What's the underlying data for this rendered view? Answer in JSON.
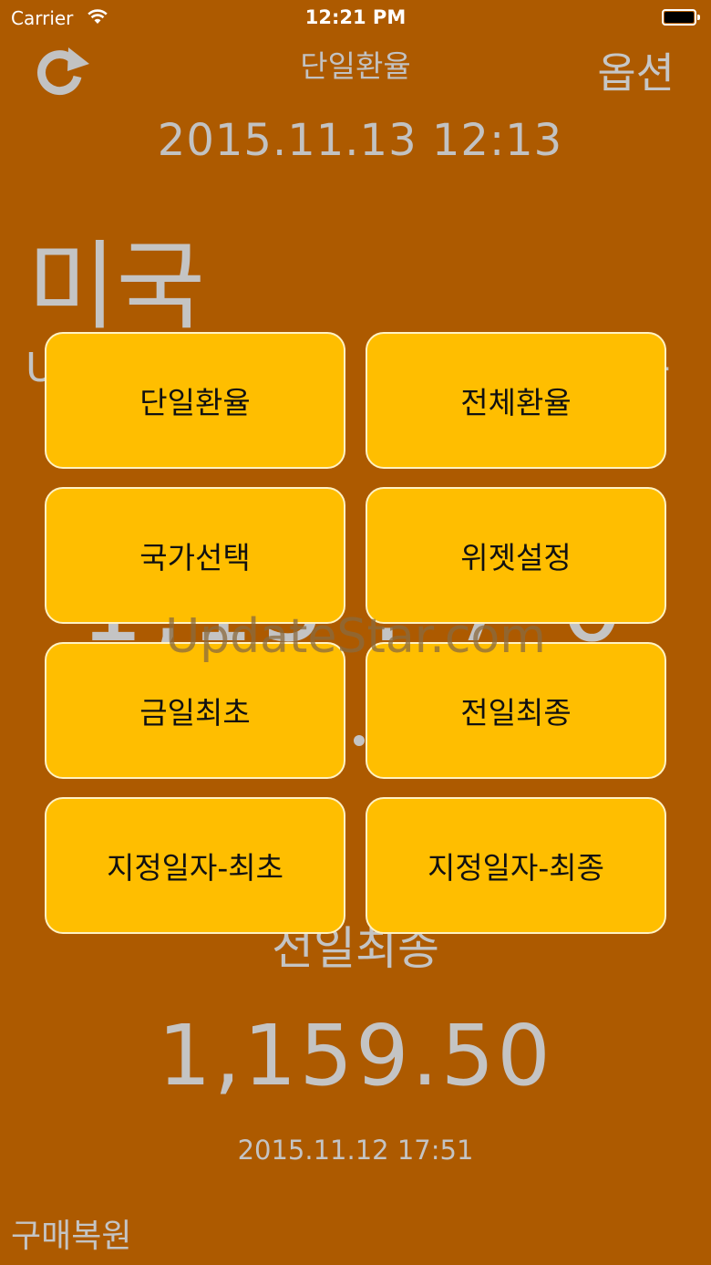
{
  "status_bar": {
    "carrier": "Carrier",
    "time": "12:21 PM"
  },
  "nav": {
    "title": "단일환율",
    "options_label": "옵션"
  },
  "background": {
    "datetime": "2015.11.13 12:13",
    "country": "미국",
    "currency_code": "U",
    "currency_right": "+",
    "big_rate": "1,15 . 7 0",
    "previous_label": "전일최종",
    "previous_rate": "1,159.50",
    "previous_datetime": "2015.11.12 17:51",
    "restore_purchase": "구매복원"
  },
  "watermark": "UpdateStar.com",
  "menu": {
    "items": [
      {
        "label": "단일환율"
      },
      {
        "label": "전체환율"
      },
      {
        "label": "국가선택"
      },
      {
        "label": "위젯설정"
      },
      {
        "label": "금일최초"
      },
      {
        "label": "전일최종"
      },
      {
        "label": "지정일자-최초"
      },
      {
        "label": "지정일자-최종"
      }
    ]
  },
  "colors": {
    "background": "#ad5a00",
    "button": "#ffbe00",
    "text_muted": "#c4c4c4"
  }
}
